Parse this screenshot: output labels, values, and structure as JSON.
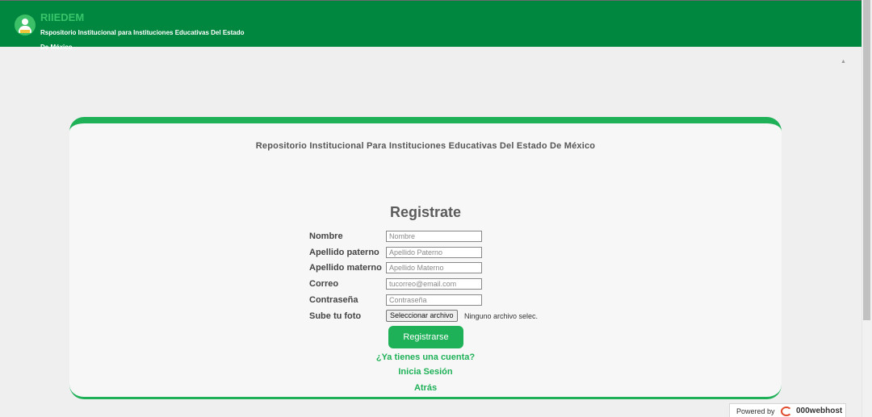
{
  "header": {
    "brand": "RIIEDEM",
    "subtitle": "Rspositorio Institucional para Instituciones Educativas Del Estado De México",
    "icons": [
      "user-reading-logo"
    ],
    "color": "#00873f"
  },
  "card": {
    "title": "Repositorio Institucional Para Instituciones Educativas Del Estado De México",
    "form_title": "Registrate",
    "accent": "#1fb158"
  },
  "form": {
    "fields": [
      {
        "label": "Nombre",
        "placeholder": "Nombre",
        "value": ""
      },
      {
        "label": "Apellido paterno",
        "placeholder": "Apellido Paterno",
        "value": ""
      },
      {
        "label": "Apellido materno",
        "placeholder": "Apellido Materno",
        "value": ""
      },
      {
        "label": "Correo",
        "placeholder": "tucorreo@email.com",
        "value": ""
      },
      {
        "label": "Contraseña",
        "placeholder": "Contraseña",
        "value": ""
      }
    ],
    "photo": {
      "label": "Sube tu foto",
      "button": "Seleccionar archivo",
      "status": "Ninguno archivo selec."
    },
    "submit": "Registrarse",
    "has_account": "¿Ya tienes una cuenta?",
    "login": "Inicia Sesión",
    "back": "Atrás"
  },
  "footer": {
    "powered_by": "Powered by",
    "host": "000webhost"
  }
}
